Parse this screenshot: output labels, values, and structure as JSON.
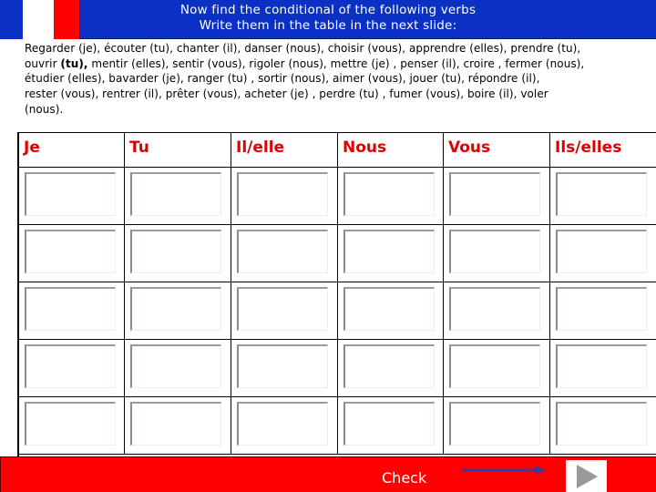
{
  "header": {
    "title_line1": "Now find the conditional of the following verbs",
    "title_line2": "Write them in the table in the next slide:",
    "flag_colors": [
      "#0a31c4",
      "#ffffff",
      "#ff0000"
    ]
  },
  "verbs_text": {
    "line1": "Regarder (je), écouter (tu), chanter (il), danser (nous), choisir (vous), apprendre (elles), prendre (tu),",
    "line2_start": "ouvrir ",
    "line2_bold": "(tu),",
    "line2_rest": " mentir (elles), sentir (vous), rigoler (nous), mettre (je) , penser (il), croire , fermer (nous),",
    "line3": "étudier (elles), bavarder (je), ranger (tu) , sortir (nous),  aimer (vous),  jouer (tu), répondre (il),",
    "line4": "rester (vous),  rentrer (il), prêter (vous), acheter (je) , perdre (tu) , fumer (vous),  boire (il), voler",
    "line5": "(nous)."
  },
  "table": {
    "headers": [
      "Je",
      "Tu",
      "Il/elle",
      "Nous",
      "Vous",
      "Ils/elles"
    ],
    "rows": [
      [
        "",
        "",
        "",
        "",
        "",
        ""
      ],
      [
        "",
        "",
        "",
        "",
        "",
        ""
      ],
      [
        "",
        "",
        "",
        "",
        "",
        ""
      ],
      [
        "",
        "",
        "",
        "",
        "",
        ""
      ],
      [
        "",
        "",
        "",
        "",
        "",
        ""
      ]
    ],
    "header_color": "#e00000"
  },
  "footer": {
    "check_label": "Check",
    "arrow_icon": "right-arrow-icon",
    "next_icon": "play-next-icon",
    "bar_color": "#ff0000"
  }
}
